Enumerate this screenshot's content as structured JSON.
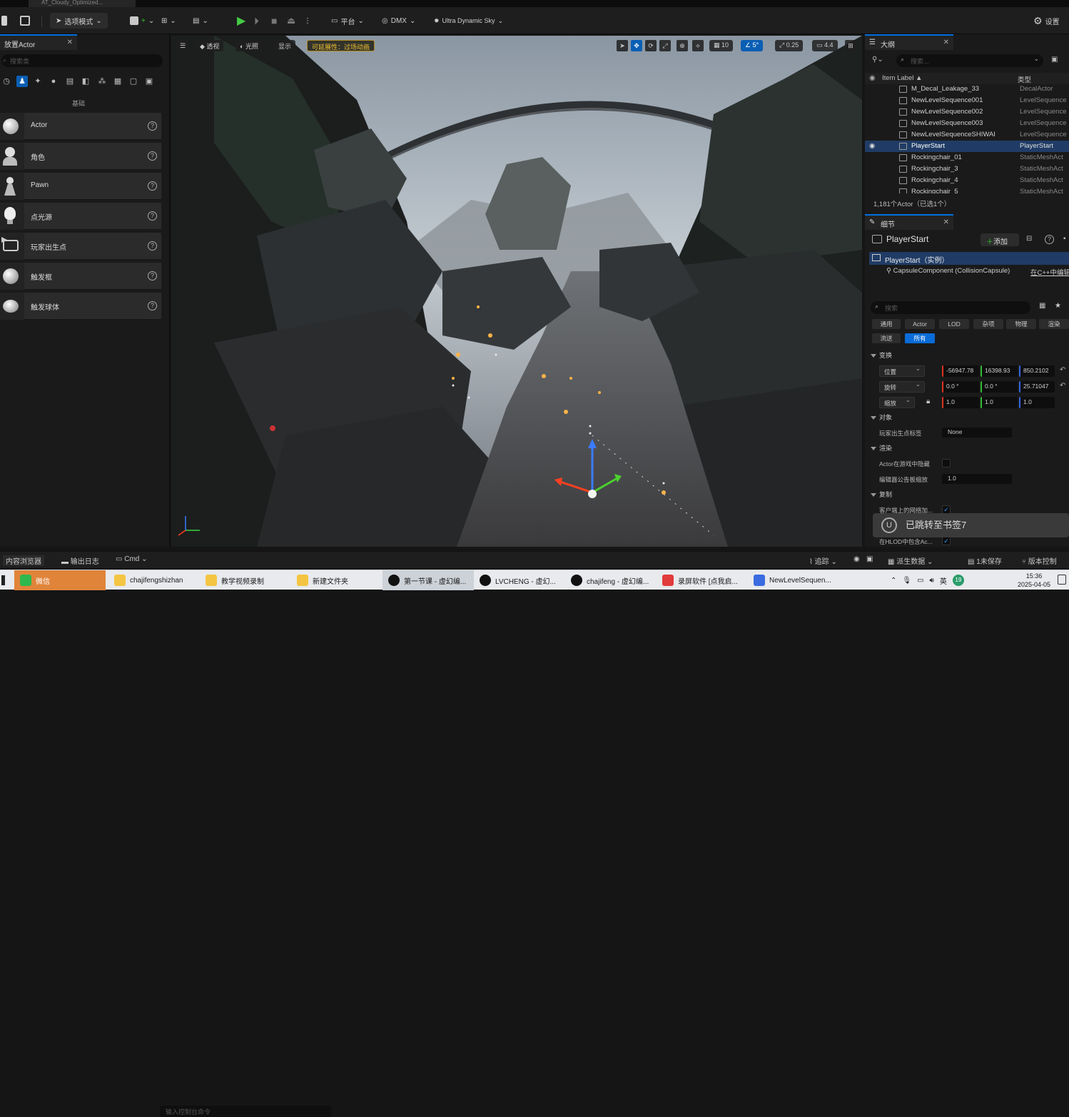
{
  "titlebar": {
    "tab_label": "AT_Cloudy_Optimized..."
  },
  "toolbar": {
    "mode_label": "选项模式",
    "platform_label": "平台",
    "dmx_label": "DMX",
    "sky_label": "Ultra Dynamic Sky",
    "settings_label": "设置"
  },
  "place_actor": {
    "tab_label": "放置Actor",
    "search_placeholder": "搜索类",
    "section_label": "基础",
    "items": [
      {
        "label": "Actor"
      },
      {
        "label": "角色"
      },
      {
        "label": "Pawn"
      },
      {
        "label": "点光源"
      },
      {
        "label": "玩家出生点"
      },
      {
        "label": "触发框"
      },
      {
        "label": "触发球体"
      }
    ]
  },
  "viewport": {
    "perspective_label": "透视",
    "lighting_label": "光照",
    "show_label": "显示",
    "scalability_label": "可延展性：过场动画",
    "grid_value": "10",
    "angle_value": "5°",
    "scale_value": "0.25",
    "camera_speed": "4.4"
  },
  "outliner": {
    "tab_label": "大纲",
    "search_placeholder": "搜索...",
    "col_label": "Item Label",
    "col_type": "类型",
    "rows": [
      {
        "name": "M_Decal_Leakage_33",
        "type": "DecalActor"
      },
      {
        "name": "NewLevelSequence001",
        "type": "LevelSequence"
      },
      {
        "name": "NewLevelSequence002",
        "type": "LevelSequence"
      },
      {
        "name": "NewLevelSequence003",
        "type": "LevelSequence"
      },
      {
        "name": "NewLevelSequenceSHIWAI",
        "type": "LevelSequence"
      },
      {
        "name": "PlayerStart",
        "type": "PlayerStart"
      },
      {
        "name": "Rockingchair_01",
        "type": "StaticMeshAct"
      },
      {
        "name": "Rockingchair_3",
        "type": "StaticMeshAct"
      },
      {
        "name": "Rockingchair_4",
        "type": "StaticMeshAct"
      },
      {
        "name": "Rockingchair_5",
        "type": "StaticMeshAct"
      }
    ],
    "footer": "1,181个Actor（已选1个）"
  },
  "details": {
    "tab_label": "细节",
    "actor_name": "PlayerStart",
    "add_label": "添加",
    "instance_label": "PlayerStart（实例）",
    "component_label": "CapsuleComponent (CollisionCapsule)",
    "cpp_link": "在C++中编辑",
    "search_placeholder": "搜索",
    "filters": [
      "通用",
      "Actor",
      "LOD",
      "杂项",
      "物理",
      "渲染",
      "流送",
      "所有"
    ],
    "transform_label": "变换",
    "location_label": "位置",
    "location": [
      "-56947.78",
      "16398.93",
      "850.2102"
    ],
    "rotation_label": "旋转",
    "rotation": [
      "0.0 °",
      "0.0 °",
      "25.71047"
    ],
    "scale_label": "缩放",
    "scale": [
      "1.0",
      "1.0",
      "1.0"
    ],
    "object_label": "对象",
    "tag_label": "玩家出生点标签",
    "tag_value": "None",
    "render_label": "渲染",
    "hidden_label": "Actor在游戏中隐藏",
    "billboard_label": "编辑器公告板缩放",
    "billboard_value": "1.0",
    "replication_label": "复制",
    "net_label": "客户端上的网络加...",
    "hlod_label": "在HLOD中包含Ac..."
  },
  "toast": {
    "text": "已跳转至书签7"
  },
  "bottombar": {
    "content_browser": "内容浏览器",
    "output_log": "输出日志",
    "cmd_label": "Cmd",
    "console_placeholder": "输入控制台命令",
    "trace_label": "追踪",
    "derived_data": "派生数据",
    "unsaved": "1未保存",
    "version_control": "版本控制"
  },
  "taskbar": {
    "items": [
      {
        "label": "微信"
      },
      {
        "label": "chajifengshizhan"
      },
      {
        "label": "教学视频录制"
      },
      {
        "label": "新建文件夹"
      },
      {
        "label": "第一节课 - 虚幻编..."
      },
      {
        "label": "LVCHENG - 虚幻..."
      },
      {
        "label": "chajifeng - 虚幻编..."
      },
      {
        "label": "录屏软件 [点我启..."
      },
      {
        "label": "NewLevelSequen..."
      }
    ],
    "lang": "英",
    "badge": "19",
    "time": "15:36",
    "date": "2025-04-05"
  }
}
